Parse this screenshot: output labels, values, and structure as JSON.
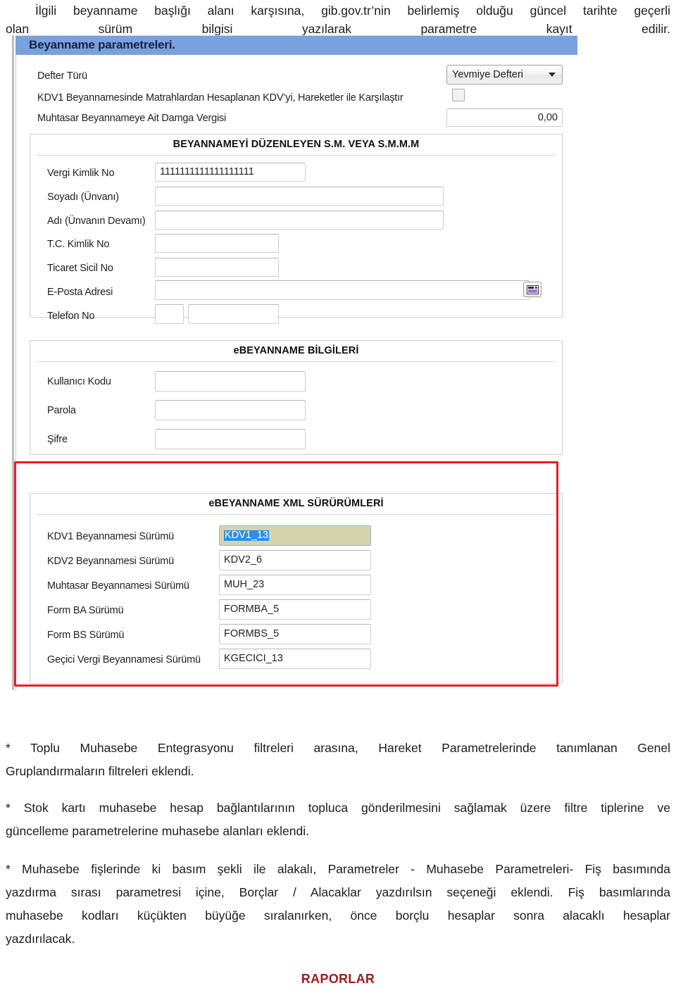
{
  "intro": {
    "line1": "İlgili beyanname başlığı alanı karşısına, gib.gov.tr’nin belirlemiş olduğu güncel tarihte geçerli",
    "line2": "olan sürüm bilgisi yazılarak parametre kayıt edilir."
  },
  "window": {
    "title": "Beyanname parametreleri."
  },
  "top_section": {
    "defter_turu_label": "Defter Türü",
    "defter_turu_value": "Yevmiye Defteri",
    "kdv1_compare_label": "KDV1 Beyannamesinde Matrahlardan Hesaplanan KDV’yi, Hareketler ile Karşılaştır",
    "kdv1_compare_checked": false,
    "damga_label": "Muhtasar Beyannameye Ait Damga Vergisi",
    "damga_value": "0,00"
  },
  "duzenleyen": {
    "title": "BEYANNAMEYİ DÜZENLEYEN  S.M. VEYA S.M.M.M",
    "fields": [
      {
        "label": "Vergi Kimlik No",
        "value": "1111111111111111111"
      },
      {
        "label": "Soyadı (Ünvanı)",
        "value": ""
      },
      {
        "label": "Adı (Ünvanın Devamı)",
        "value": ""
      },
      {
        "label": "T.C. Kimlik No",
        "value": ""
      },
      {
        "label": "Ticaret Sicil No",
        "value": ""
      },
      {
        "label": "E-Posta Adresi",
        "value": ""
      },
      {
        "label": "Telefon No",
        "value": ""
      }
    ],
    "telefon_area_value": ""
  },
  "ebeyanname": {
    "title": "eBEYANNAME BİLGİLERİ",
    "fields": [
      {
        "label": "Kullanıcı Kodu",
        "value": ""
      },
      {
        "label": "Parola",
        "value": ""
      },
      {
        "label": "Şifre",
        "value": ""
      }
    ]
  },
  "xml_surumleri": {
    "title": "eBEYANNAME XML SÜRÜRÜMLERİ",
    "fields": [
      {
        "label": "KDV1 Beyannamesi Sürümü",
        "value": "KDV1_13",
        "selected": true
      },
      {
        "label": "KDV2 Beyannamesi Sürümü",
        "value": "KDV2_6",
        "selected": false
      },
      {
        "label": "Muhtasar Beyannamesi Sürümü",
        "value": "MUH_23",
        "selected": false
      },
      {
        "label": "Form BA Sürümü",
        "value": "FORMBA_5",
        "selected": false
      },
      {
        "label": "Form BS Sürümü",
        "value": "FORMBS_5",
        "selected": false
      },
      {
        "label": "Geçici Vergi Beyannamesi Sürümü",
        "value": "KGECICI_13",
        "selected": false
      }
    ]
  },
  "notes": {
    "note1_a": "* Toplu Muhasebe Entegrasyonu filtreleri arasına, Hareket Parametrelerinde tanımlanan Genel",
    "note1_b": "Gruplandırmaların filtreleri eklendi.",
    "note2_a": "* Stok kartı muhasebe hesap bağlantılarının topluca gönderilmesini sağlamak üzere filtre tiplerine ve",
    "note2_b": "güncelleme parametrelerine muhasebe alanları eklendi.",
    "note3_a": "* Muhasebe fişlerinde ki basım şekli ile alakalı, Parametreler - Muhasebe Parametreleri- Fiş basımında",
    "note3_b": "yazdırma sırası parametresi içine, Borçlar / Alacaklar yazdırılsın seçeneği eklendi. Fiş basımlarında",
    "note3_c": "muhasebe kodları küçükten büyüğe sıralanırken, önce borçlu hesaplar sonra alacaklı hesaplar",
    "note3_d": "yazdırılacak."
  },
  "footer": {
    "raporlar": "RAPORLAR"
  },
  "colors": {
    "titlebar": "#7ba0de",
    "highlight_border": "#ec1c24",
    "selection": "#2a8fe8",
    "footer_text": "#9e1b1b"
  }
}
